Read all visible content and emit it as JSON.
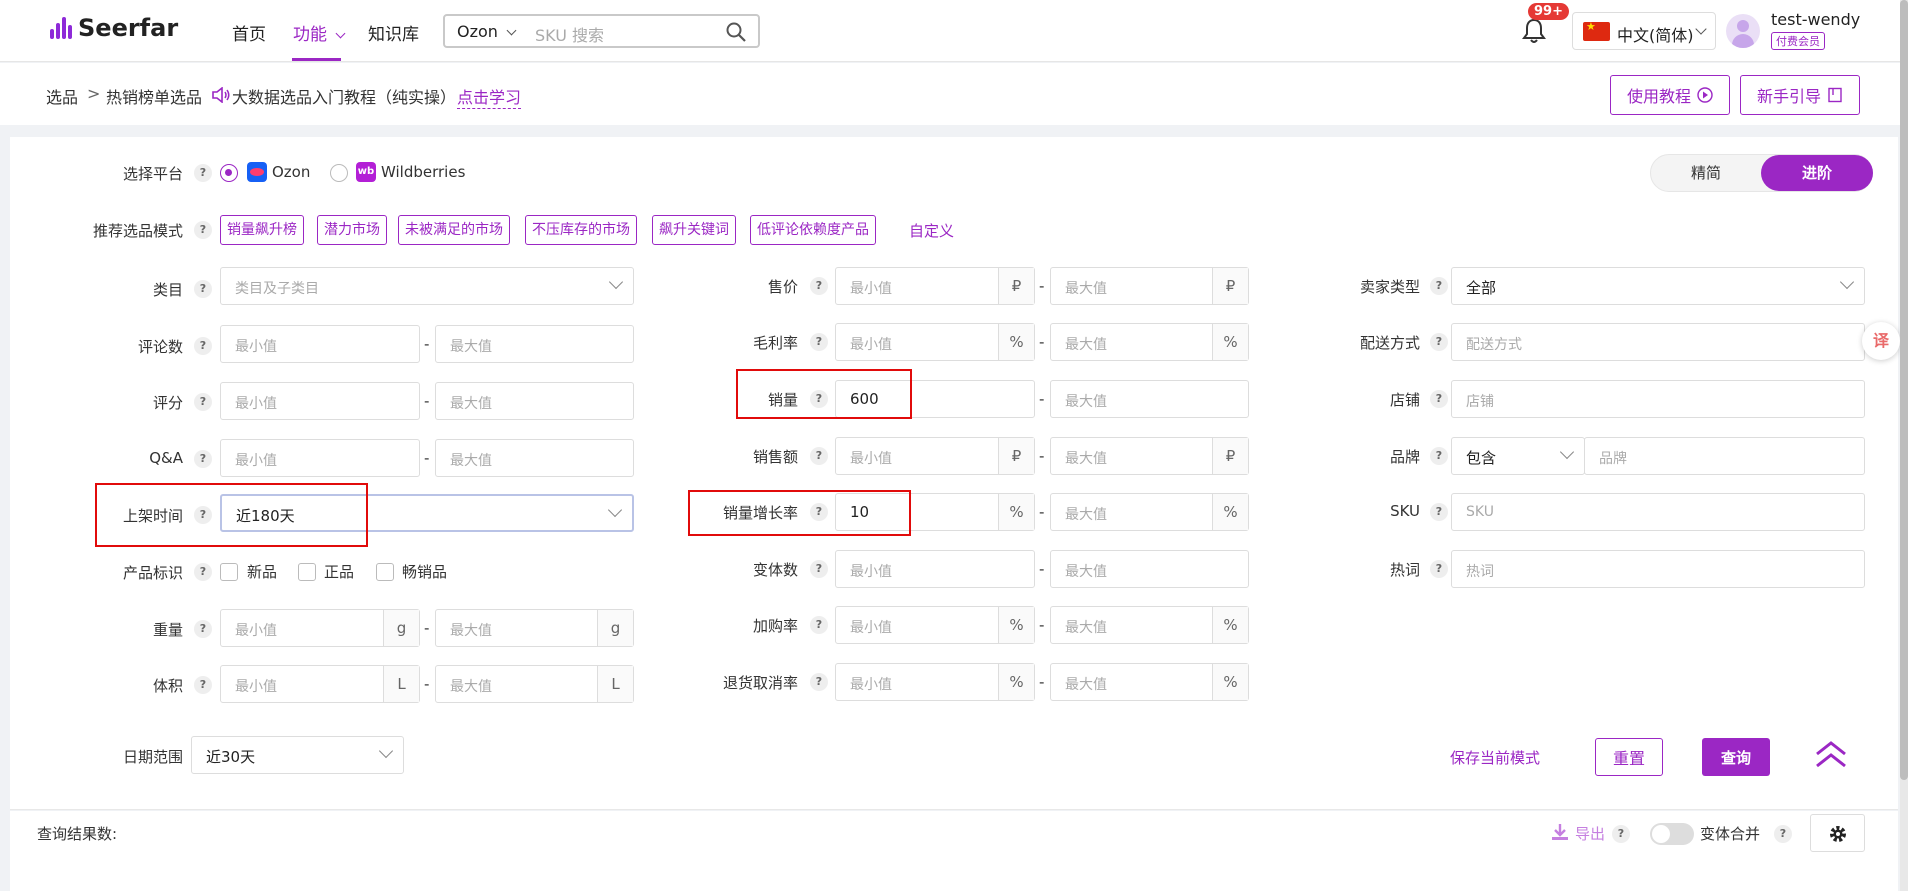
{
  "header": {
    "logo": "Seerfar",
    "nav": [
      "首页",
      "功能",
      "知识库"
    ],
    "nav_active_chevron": "chevron-down-icon",
    "search_platform": "Ozon",
    "search_placeholder": "SKU 搜索",
    "notification_badge": "99+",
    "language": "中文(简体)",
    "username": "test-wendy",
    "member_badge": "付费会员"
  },
  "breadcrumb": {
    "root": "选品",
    "sep": ">",
    "current": "热销榜单选品",
    "tutorial_text": "大数据选品入门教程（纯实操）",
    "learn_link": "点击学习",
    "btn_tutorial": "使用教程",
    "btn_guide": "新手引导"
  },
  "filters": {
    "platform_label": "选择平台",
    "platform_options": [
      "Ozon",
      "Wildberries"
    ],
    "platform_selected": "Ozon",
    "view_modes": [
      "精简",
      "进阶"
    ],
    "view_selected": "进阶",
    "mode_label": "推荐选品模式",
    "modes": [
      "销量飙升榜",
      "潜力市场",
      "未被满足的市场",
      "不压库存的市场",
      "飙升关键词",
      "低评论依赖度产品"
    ],
    "custom": "自定义",
    "min_ph": "最小值",
    "max_ph": "最大值",
    "col1": {
      "category_label": "类目",
      "category_ph": "类目及子类目",
      "reviews_label": "评论数",
      "rating_label": "评分",
      "qa_label": "Q&A",
      "listing_label": "上架时间",
      "listing_value": "近180天",
      "tags_label": "产品标识",
      "tags": [
        "新品",
        "正品",
        "畅销品"
      ],
      "weight_label": "重量",
      "weight_unit": "g",
      "volume_label": "体积",
      "volume_unit": "L"
    },
    "col2": {
      "price_label": "售价",
      "currency": "₽",
      "margin_label": "毛利率",
      "pct": "%",
      "sales_label": "销量",
      "sales_min": "600",
      "revenue_label": "销售额",
      "growth_label": "销量增长率",
      "growth_min": "10",
      "variants_label": "变体数",
      "cart_label": "加购率",
      "return_label": "退货取消率"
    },
    "col3": {
      "seller_label": "卖家类型",
      "seller_value": "全部",
      "delivery_label": "配送方式",
      "delivery_ph": "配送方式",
      "shop_label": "店铺",
      "shop_ph": "店铺",
      "brand_label": "品牌",
      "brand_mode": "包含",
      "brand_ph": "品牌",
      "sku_label": "SKU",
      "sku_ph": "SKU",
      "hotword_label": "热词",
      "hotword_ph": "热词"
    },
    "date_label": "日期范围",
    "date_value": "近30天",
    "save_mode": "保存当前模式",
    "reset": "重置",
    "query": "查询"
  },
  "results": {
    "count_label": "查询结果数:",
    "export": "导出",
    "merge_label": "变体合并"
  },
  "colors": {
    "accent": "#9b27c4",
    "highlight": "#e10b0b"
  }
}
